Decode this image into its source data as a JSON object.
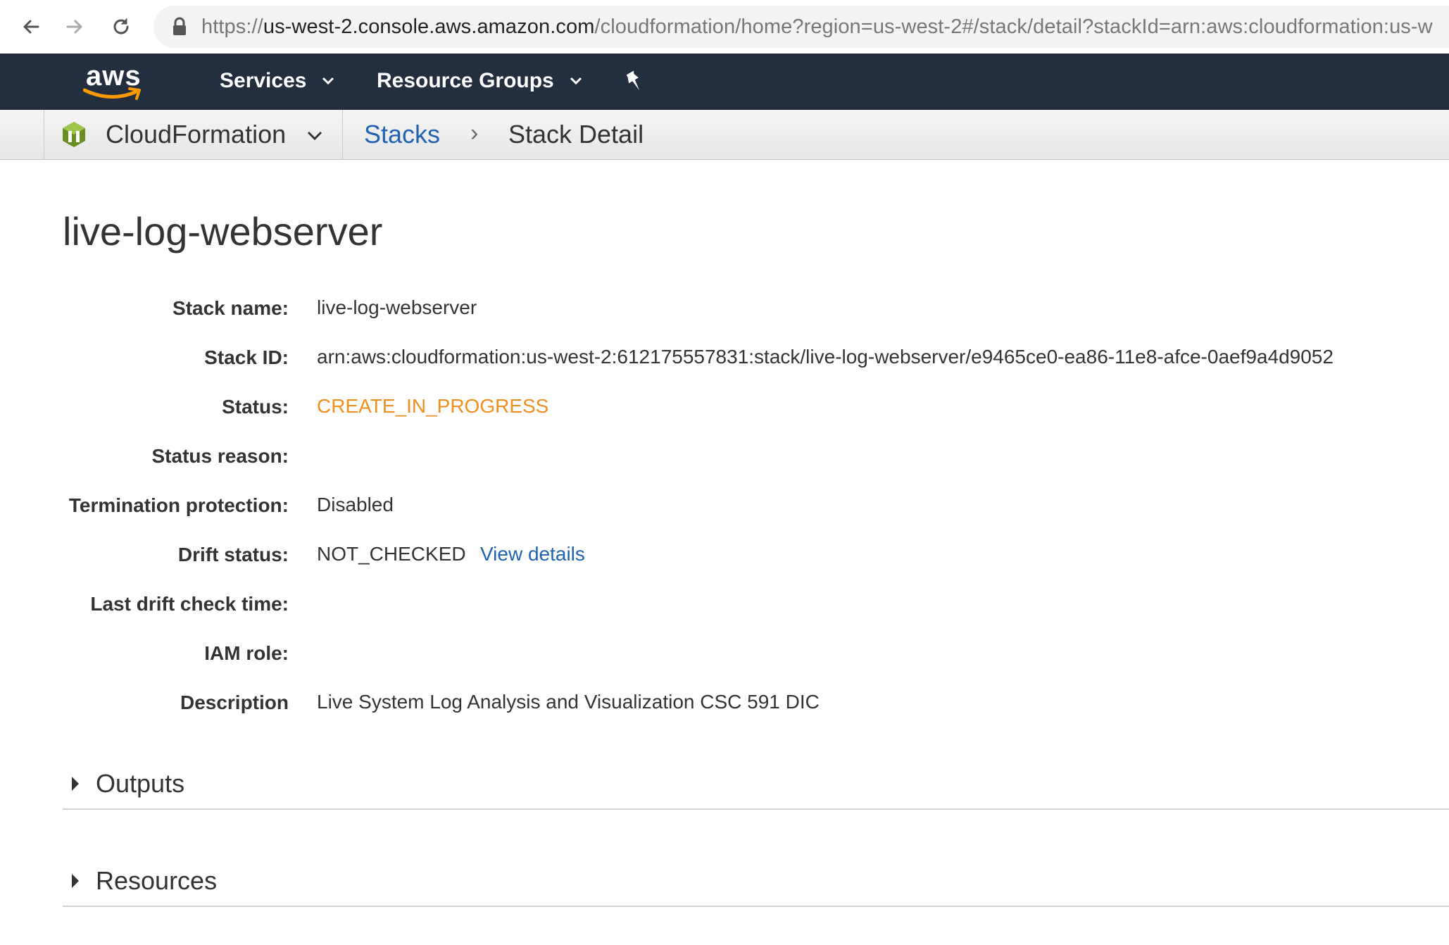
{
  "browser": {
    "url_scheme": "https://",
    "url_host": "us-west-2.console.aws.amazon.com",
    "url_path": "/cloudformation/home?region=us-west-2#/stack/detail?stackId=arn:aws:cloudformation:us-w"
  },
  "navbar": {
    "logo_text": "aws",
    "services_label": "Services",
    "resource_groups_label": "Resource Groups"
  },
  "subnav": {
    "service_name": "CloudFormation",
    "breadcrumb_link": "Stacks",
    "breadcrumb_separator": "›",
    "breadcrumb_current": "Stack Detail"
  },
  "page": {
    "title": "live-log-webserver"
  },
  "details": {
    "stack_name_label": "Stack name:",
    "stack_name_value": "live-log-webserver",
    "stack_id_label": "Stack ID:",
    "stack_id_value": "arn:aws:cloudformation:us-west-2:612175557831:stack/live-log-webserver/e9465ce0-ea86-11e8-afce-0aef9a4d9052",
    "status_label": "Status:",
    "status_value": "CREATE_IN_PROGRESS",
    "status_color": "#ef8f1f",
    "status_reason_label": "Status reason:",
    "termination_protection_label": "Termination protection:",
    "termination_protection_value": "Disabled",
    "drift_status_label": "Drift status:",
    "drift_status_value": "NOT_CHECKED",
    "view_details_link": "View details",
    "last_drift_check_label": "Last drift check time:",
    "iam_role_label": "IAM role:",
    "description_label": "Description",
    "description_value": "Live System Log Analysis and Visualization CSC 591 DIC"
  },
  "sections": {
    "outputs_label": "Outputs",
    "resources_label": "Resources"
  },
  "colors": {
    "aws_nav_bg": "#232f3e",
    "link_blue": "#1f63b2",
    "aws_orange": "#ff9900"
  }
}
